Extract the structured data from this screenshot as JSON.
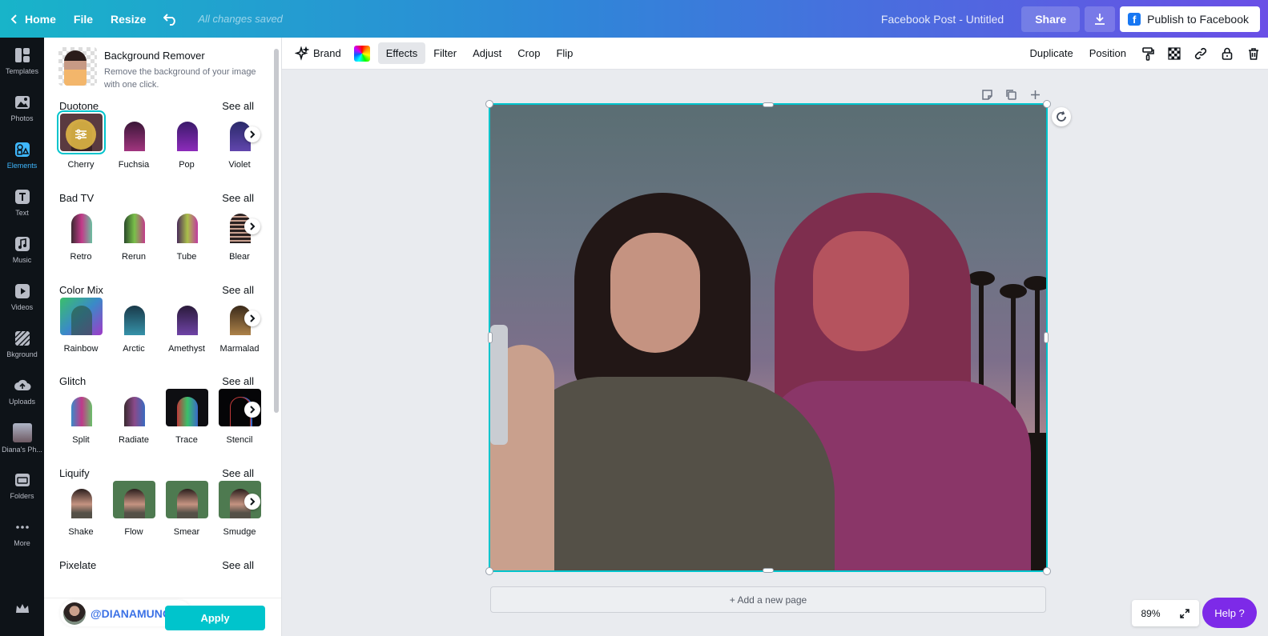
{
  "topbar": {
    "home_label": "Home",
    "file_label": "File",
    "resize_label": "Resize",
    "save_status": "All changes saved",
    "document_title": "Facebook Post - Untitled",
    "share_label": "Share",
    "publish_label": "Publish to Facebook"
  },
  "leftnav": {
    "items": [
      {
        "label": "Templates",
        "icon": "templates-icon"
      },
      {
        "label": "Photos",
        "icon": "photos-icon"
      },
      {
        "label": "Elements",
        "icon": "elements-icon"
      },
      {
        "label": "Text",
        "icon": "text-icon"
      },
      {
        "label": "Music",
        "icon": "music-icon"
      },
      {
        "label": "Videos",
        "icon": "videos-icon"
      },
      {
        "label": "Bkground",
        "icon": "background-icon"
      },
      {
        "label": "Uploads",
        "icon": "uploads-icon"
      },
      {
        "label": "Diana's Ph...",
        "icon": "folder-thumbnail"
      },
      {
        "label": "Folders",
        "icon": "folders-icon"
      },
      {
        "label": "More",
        "icon": "more-icon"
      }
    ],
    "active": "Elements"
  },
  "panel": {
    "bg_remover": {
      "title": "Background Remover",
      "description": "Remove the background of your image with one click."
    },
    "see_all_label": "See all",
    "sections": [
      {
        "title": "Duotone",
        "effects": [
          "Cherry",
          "Fuchsia",
          "Pop",
          "Violet"
        ],
        "selected": "Cherry"
      },
      {
        "title": "Bad TV",
        "effects": [
          "Retro",
          "Rerun",
          "Tube",
          "Blear"
        ]
      },
      {
        "title": "Color Mix",
        "effects": [
          "Rainbow",
          "Arctic",
          "Amethyst",
          "Marmalad"
        ]
      },
      {
        "title": "Glitch",
        "effects": [
          "Split",
          "Radiate",
          "Trace",
          "Stencil"
        ]
      },
      {
        "title": "Liquify",
        "effects": [
          "Shake",
          "Flow",
          "Smear",
          "Smudge"
        ]
      },
      {
        "title": "Pixelate",
        "effects": []
      }
    ],
    "apply_label": "Apply",
    "username": "@DIANAMUNOZ"
  },
  "toolbar": {
    "brand_label": "Brand",
    "effects_label": "Effects",
    "filter_label": "Filter",
    "adjust_label": "Adjust",
    "crop_label": "Crop",
    "flip_label": "Flip",
    "duplicate_label": "Duplicate",
    "position_label": "Position"
  },
  "canvas": {
    "add_page_label": "+ Add a new page",
    "zoom": "89%",
    "help_label": "Help ?"
  },
  "colors": {
    "accent": "#00c4cc",
    "help": "#7d2ae8",
    "nav_bg": "#0e1318",
    "active_nav": "#3fb8ff"
  }
}
